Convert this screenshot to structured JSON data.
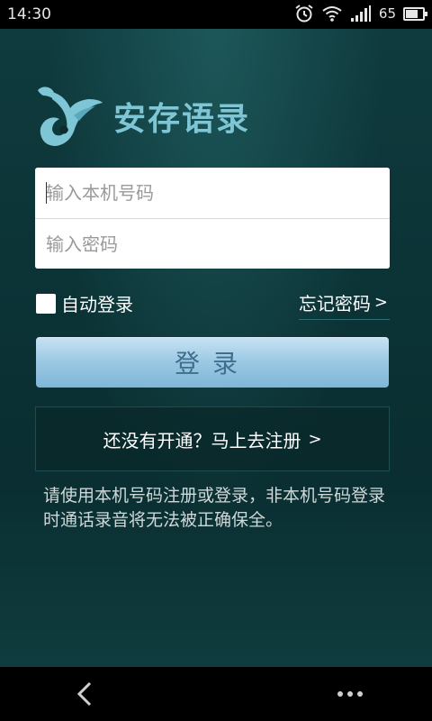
{
  "status_bar": {
    "time": "14:30",
    "battery": "65",
    "battery_level": 0.65,
    "icons": [
      "alarm-icon",
      "wifi-icon",
      "signal-icon",
      "battery-icon"
    ]
  },
  "app": {
    "name": "安存语录",
    "logo_icon": "bird-logo-icon"
  },
  "form": {
    "phone_placeholder": "输入本机号码",
    "password_placeholder": "输入密码",
    "phone_value": "",
    "password_value": ""
  },
  "auto_login": {
    "label": "自动登录",
    "checked": false
  },
  "forgot_password": {
    "label": "忘记密码",
    "chevron": ">"
  },
  "login_button": {
    "label": "登录"
  },
  "register": {
    "label": "还没有开通？马上去注册",
    "chevron": ">"
  },
  "notice": "请使用本机号码注册或登录，非本机号码登录时通话录音将无法被正确保全。",
  "nav_bar": {
    "icons": [
      "back-icon",
      "more-icon"
    ]
  },
  "colors": {
    "background": "#0c2c2e",
    "logo": "#7ec6d5",
    "login_button": "#9bc8e3"
  }
}
